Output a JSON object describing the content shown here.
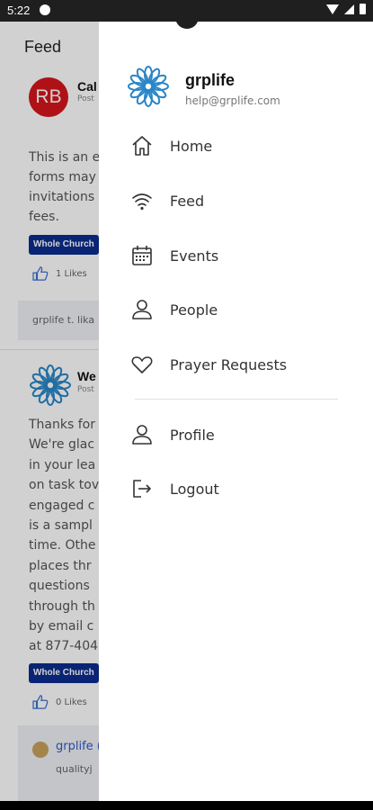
{
  "status_bar": {
    "time": "5:22"
  },
  "feed": {
    "title": "Feed",
    "posts": [
      {
        "avatar_initials": "RB",
        "name": "Cal",
        "sub": "Post",
        "text_lines": [
          "This is an e",
          "forms may",
          "invitations",
          "fees."
        ],
        "tag": "Whole Church",
        "likes": "1 Likes",
        "comment": "grplife t. lika"
      },
      {
        "name": "We",
        "sub": "Post",
        "text_lines": [
          "Thanks for",
          "We're glac",
          "in your lea",
          "on task tov",
          "engaged c",
          "is a sampl",
          "time. Othe",
          "places thr",
          "questions",
          "through th",
          "by email c",
          "at 877-404"
        ],
        "tag": "Whole Church",
        "likes": "0 Likes",
        "comment_name": "grplife (",
        "comment_text": "qualityj"
      }
    ]
  },
  "drawer": {
    "app_name": "grplife",
    "email": "help@grplife.com",
    "menu": [
      {
        "label": "Home",
        "icon": "home-icon"
      },
      {
        "label": "Feed",
        "icon": "wifi-icon"
      },
      {
        "label": "Events",
        "icon": "calendar-icon"
      },
      {
        "label": "People",
        "icon": "person-icon"
      },
      {
        "label": "Prayer Requests",
        "icon": "heart-icon"
      }
    ],
    "secondary_menu": [
      {
        "label": "Profile",
        "icon": "person-icon"
      },
      {
        "label": "Logout",
        "icon": "logout-icon"
      }
    ]
  },
  "colors": {
    "accent_blue": "#0b2d8f",
    "avatar_red": "#d5171b",
    "logo_blue": "#2a86c7"
  }
}
